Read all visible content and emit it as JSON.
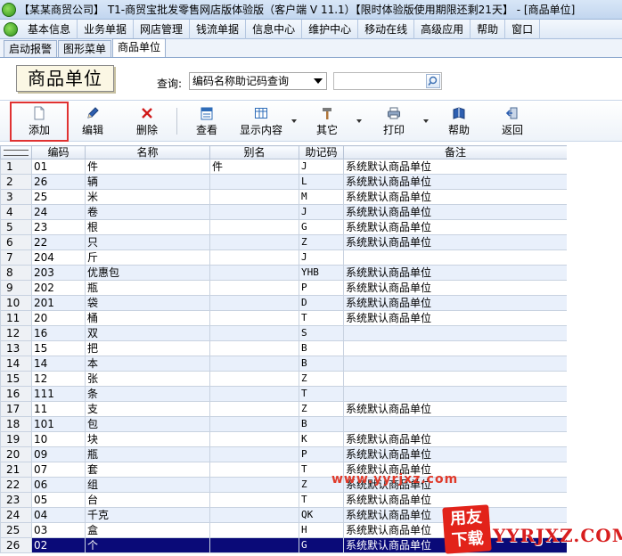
{
  "window": {
    "title": "【某某商贸公司】 T1-商贸宝批发零售网店版体验版（客户端 V 11.1）【限时体验版使用期限还剩21天】 - [商品单位]"
  },
  "menu": [
    "基本信息",
    "业务单据",
    "网店管理",
    "钱流单据",
    "信息中心",
    "维护中心",
    "移动在线",
    "高级应用",
    "帮助",
    "窗口"
  ],
  "tabs": [
    {
      "label": "启动报警",
      "active": false
    },
    {
      "label": "图形菜单",
      "active": false
    },
    {
      "label": "商品单位",
      "active": true
    }
  ],
  "header": {
    "page_title": "商品单位",
    "query_label": "查询:",
    "query_mode": "编码名称助记码查询",
    "search_value": ""
  },
  "toolbar": {
    "add": "添加",
    "edit": "编辑",
    "delete": "删除",
    "view": "查看",
    "display": "显示内容",
    "other": "其它",
    "print": "打印",
    "help": "帮助",
    "back": "返回"
  },
  "grid": {
    "columns": [
      "编码",
      "名称",
      "别名",
      "助记码",
      "备注"
    ],
    "selected_row": 26,
    "rows": [
      {
        "n": "1",
        "code": "01",
        "name": "件",
        "alias": "件",
        "mnemonic": "J",
        "note": "系统默认商品单位"
      },
      {
        "n": "2",
        "code": "26",
        "name": "辆",
        "alias": "",
        "mnemonic": "L",
        "note": "系统默认商品单位"
      },
      {
        "n": "3",
        "code": "25",
        "name": "米",
        "alias": "",
        "mnemonic": "M",
        "note": "系统默认商品单位"
      },
      {
        "n": "4",
        "code": "24",
        "name": "卷",
        "alias": "",
        "mnemonic": "J",
        "note": "系统默认商品单位"
      },
      {
        "n": "5",
        "code": "23",
        "name": "根",
        "alias": "",
        "mnemonic": "G",
        "note": "系统默认商品单位"
      },
      {
        "n": "6",
        "code": "22",
        "name": "只",
        "alias": "",
        "mnemonic": "Z",
        "note": "系统默认商品单位"
      },
      {
        "n": "7",
        "code": "204",
        "name": "斤",
        "alias": "",
        "mnemonic": "J",
        "note": ""
      },
      {
        "n": "8",
        "code": "203",
        "name": "优惠包",
        "alias": "",
        "mnemonic": "YHB",
        "note": "系统默认商品单位"
      },
      {
        "n": "9",
        "code": "202",
        "name": "瓶",
        "alias": "",
        "mnemonic": "P",
        "note": "系统默认商品单位"
      },
      {
        "n": "10",
        "code": "201",
        "name": "袋",
        "alias": "",
        "mnemonic": "D",
        "note": "系统默认商品单位"
      },
      {
        "n": "11",
        "code": "20",
        "name": "桶",
        "alias": "",
        "mnemonic": "T",
        "note": "系统默认商品单位"
      },
      {
        "n": "12",
        "code": "16",
        "name": "双",
        "alias": "",
        "mnemonic": "S",
        "note": ""
      },
      {
        "n": "13",
        "code": "15",
        "name": "把",
        "alias": "",
        "mnemonic": "B",
        "note": ""
      },
      {
        "n": "14",
        "code": "14",
        "name": "本",
        "alias": "",
        "mnemonic": "B",
        "note": ""
      },
      {
        "n": "15",
        "code": "12",
        "name": "张",
        "alias": "",
        "mnemonic": "Z",
        "note": ""
      },
      {
        "n": "16",
        "code": "111",
        "name": "条",
        "alias": "",
        "mnemonic": "T",
        "note": ""
      },
      {
        "n": "17",
        "code": "11",
        "name": "支",
        "alias": "",
        "mnemonic": "Z",
        "note": "系统默认商品单位"
      },
      {
        "n": "18",
        "code": "101",
        "name": "包",
        "alias": "",
        "mnemonic": "B",
        "note": ""
      },
      {
        "n": "19",
        "code": "10",
        "name": "块",
        "alias": "",
        "mnemonic": "K",
        "note": "系统默认商品单位"
      },
      {
        "n": "20",
        "code": "09",
        "name": "瓶",
        "alias": "",
        "mnemonic": "P",
        "note": "系统默认商品单位"
      },
      {
        "n": "21",
        "code": "07",
        "name": "套",
        "alias": "",
        "mnemonic": "T",
        "note": "系统默认商品单位"
      },
      {
        "n": "22",
        "code": "06",
        "name": "组",
        "alias": "",
        "mnemonic": "Z",
        "note": "系统默认商品单位"
      },
      {
        "n": "23",
        "code": "05",
        "name": "台",
        "alias": "",
        "mnemonic": "T",
        "note": "系统默认商品单位"
      },
      {
        "n": "24",
        "code": "04",
        "name": "千克",
        "alias": "",
        "mnemonic": "QK",
        "note": "系统默认商品单位"
      },
      {
        "n": "25",
        "code": "03",
        "name": "盒",
        "alias": "",
        "mnemonic": "H",
        "note": "系统默认商品单位"
      },
      {
        "n": "26",
        "code": "02",
        "name": "个",
        "alias": "",
        "mnemonic": "G",
        "note": "系统默认商品单位"
      }
    ]
  },
  "watermark": {
    "url": "www.yyrjxz.com",
    "badge_top": "用友",
    "badge_bottom": "下载",
    "site": "YYRJXZ.COM"
  },
  "colors": {
    "selection": "#0a0a78",
    "highlight_box": "#e03232",
    "watermark": "#e2231a"
  }
}
